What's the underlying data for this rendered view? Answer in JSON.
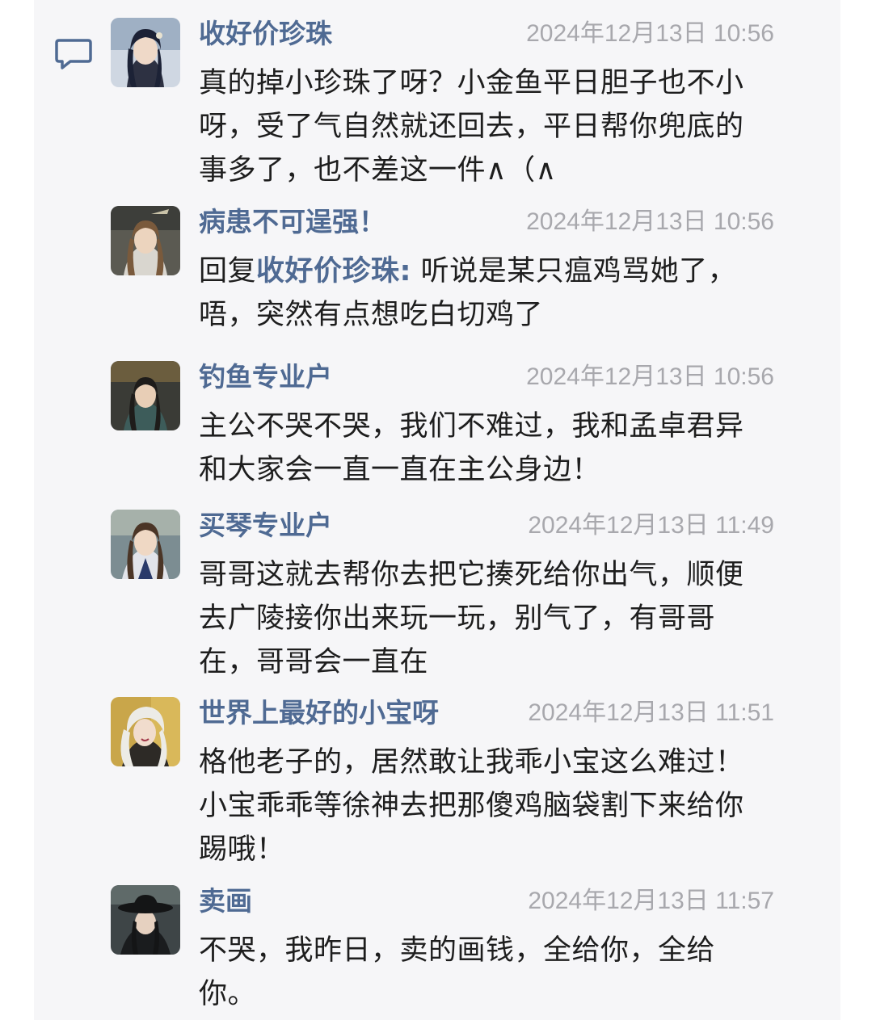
{
  "icons": {
    "reply": "reply-comment-icon"
  },
  "colors": {
    "panel_background": "#f6f6f8",
    "username": "#4f6a93",
    "timestamp": "#a8a8ad",
    "text": "#1e1e1e"
  },
  "comments": [
    {
      "username": "收好价珍珠",
      "timestamp": "2024年12月13日 10:56",
      "text": "真的掉小珍珠了呀？小金鱼平日胆子也不小呀，受了气自然就还回去，平日帮你兜底的事多了，也不差这一件∧（∧"
    },
    {
      "username": "病患不可逞强！",
      "timestamp": "2024年12月13日 10:56",
      "reply_prefix": "回复",
      "reply_to": "收好价珍珠:",
      "text": " 听说是某只瘟鸡骂她了，唔，突然有点想吃白切鸡了"
    },
    {
      "username": "钓鱼专业户",
      "timestamp": "2024年12月13日 10:56",
      "text": "主公不哭不哭，我们不难过，我和孟卓君异和大家会一直一直在主公身边！"
    },
    {
      "username": "买琴专业户",
      "timestamp": "2024年12月13日 11:49",
      "text": "哥哥这就去帮你去把它揍死给你出气，顺便去广陵接你出来玩一玩，别气了，有哥哥在，哥哥会一直在"
    },
    {
      "username": "世界上最好的小宝呀",
      "timestamp": "2024年12月13日 11:51",
      "text": "格他老子的，居然敢让我乖小宝这么难过！小宝乖乖等徐神去把那傻鸡脑袋割下来给你踢哦！"
    },
    {
      "username": "卖画",
      "timestamp": "2024年12月13日 11:57",
      "text": "不哭，我昨日，卖的画钱，全给你，全给你。"
    }
  ]
}
